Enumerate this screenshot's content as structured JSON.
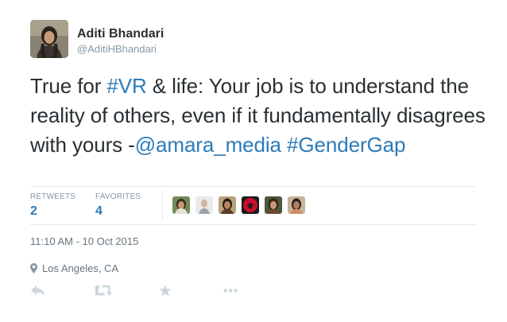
{
  "author": {
    "display_name": "Aditi Bhandari",
    "screen_name": "@AditiHBhandari",
    "avatar_icon": "profile-photo"
  },
  "tweet": {
    "segments": [
      {
        "text": "True for ",
        "link": false
      },
      {
        "text": "#VR",
        "link": true
      },
      {
        "text": " & life: Your job is to understand the reality of others, even if it fundamentally disagrees with yours -",
        "link": false
      },
      {
        "text": "@amara_media",
        "link": true
      },
      {
        "text": " ",
        "link": false
      },
      {
        "text": "#GenderGap",
        "link": true
      }
    ]
  },
  "stats": {
    "retweets_label": "RETWEETS",
    "retweets_value": "2",
    "favorites_label": "FAVORITES",
    "favorites_value": "4"
  },
  "favoriters": [
    {
      "name": "favoriter-avatar-1",
      "icon": "profile-photo"
    },
    {
      "name": "favoriter-avatar-2",
      "icon": "profile-photo"
    },
    {
      "name": "favoriter-avatar-3",
      "icon": "profile-photo"
    },
    {
      "name": "favoriter-avatar-4",
      "icon": "profile-photo"
    },
    {
      "name": "favoriter-avatar-5",
      "icon": "profile-photo"
    },
    {
      "name": "favoriter-avatar-6",
      "icon": "profile-photo"
    }
  ],
  "timestamp": "11:10 AM - 10 Oct 2015",
  "location": {
    "icon": "map-pin-icon",
    "text": "Los Angeles, CA"
  },
  "actions": [
    {
      "name": "reply-button",
      "icon": "reply-icon"
    },
    {
      "name": "retweet-button",
      "icon": "retweet-icon"
    },
    {
      "name": "favorite-button",
      "icon": "star-icon"
    },
    {
      "name": "more-button",
      "icon": "more-icon"
    }
  ],
  "colors": {
    "link": "#2b7bb9",
    "text": "#292f33",
    "muted": "#8899a6",
    "divider": "#e1e8ed",
    "action_icon": "#ccd6dd"
  }
}
